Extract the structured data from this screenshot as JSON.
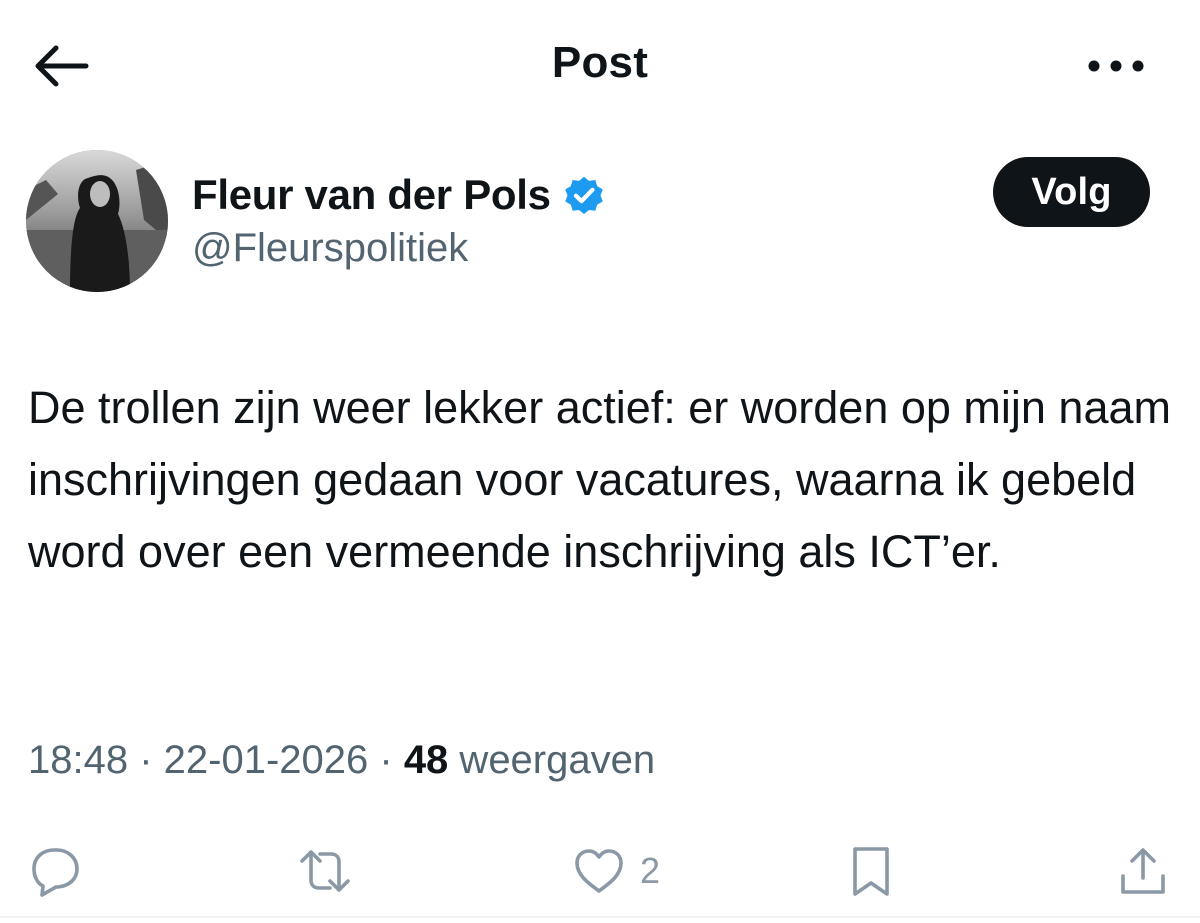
{
  "header": {
    "title": "Post",
    "back_icon": "arrow-left-icon",
    "more_icon": "more-horizontal-icon"
  },
  "author": {
    "display_name": "Fleur van der Pols",
    "handle": "@Fleurspolitiek",
    "verified_icon": "verified-badge-icon",
    "verified_color": "#1d9bf0",
    "follow_label": "Volg"
  },
  "post": {
    "text": "De trollen zijn weer lekker actief: er worden op mijn naam inschrijvingen gedaan voor vacatures, waarna ik gebeld word over een vermeende inschrijving als ICT’er."
  },
  "meta": {
    "time": "18:48",
    "separator": " · ",
    "date": "22-01-2026",
    "views_count": "48",
    "views_label": " weergaven"
  },
  "actions": {
    "reply_icon": "reply-icon",
    "repost_icon": "repost-icon",
    "like_icon": "heart-icon",
    "like_count": "2",
    "bookmark_icon": "bookmark-icon",
    "share_icon": "share-icon"
  },
  "colors": {
    "text": "#0f1419",
    "secondary_text": "#536471",
    "action_icon": "#8b98a5",
    "follow_button_bg": "#0f1419"
  }
}
